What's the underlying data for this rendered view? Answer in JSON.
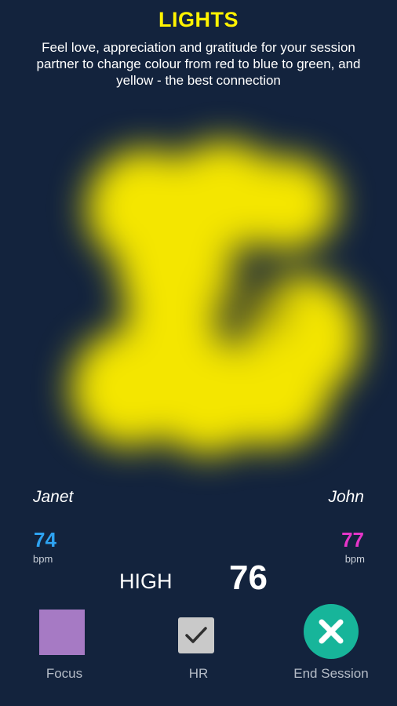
{
  "header": {
    "title": "LIGHTS",
    "subtitle": "Feel love, appreciation and gratitude for your session partner to change colour from red to blue to green, and yellow - the best connection"
  },
  "lights": {
    "color": "#f4e600",
    "state": "yellow"
  },
  "participants": {
    "left": {
      "name": "Janet",
      "heart_rate": "74",
      "unit": "bpm",
      "color": "#2ea3f2"
    },
    "right": {
      "name": "John",
      "heart_rate": "77",
      "unit": "bpm",
      "color": "#e535c8"
    }
  },
  "connection": {
    "level": "HIGH",
    "score": "76"
  },
  "controls": {
    "focus": {
      "label": "Focus",
      "color": "#a67ac4"
    },
    "hr": {
      "label": "HR",
      "checked": true,
      "icon": "check-icon"
    },
    "end_session": {
      "label": "End Session",
      "color": "#17b59a",
      "icon": "close-icon"
    }
  }
}
